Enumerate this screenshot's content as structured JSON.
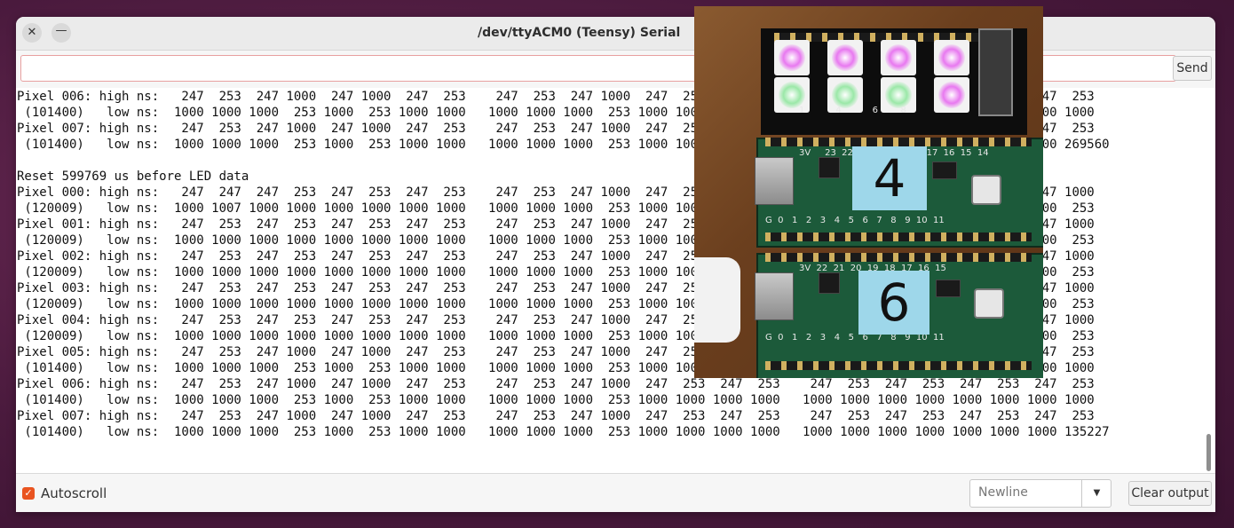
{
  "window": {
    "title": "/dev/ttyACM0 (Teensy) Serial"
  },
  "titlebar": {
    "close_icon_glyph": "✕",
    "minimize_icon_glyph": "—"
  },
  "send_bar": {
    "input_value": "",
    "send_label": "Send"
  },
  "output_lines": [
    "Pixel 006: high ns:   247  253  247 1000  247 1000  247  253    247  253  247 1000  247  253  247  253    247  253  247  253  247  253  247  253",
    " (101400)   low ns:  1000 1000 1000  253 1000  253 1000 1000   1000 1000 1000  253 1000 1000 1000 1000   1000 1000 1000 1000 1000 1000 1000 1000",
    "Pixel 007: high ns:   247  253  247 1000  247 1000  247  253    247  253  247 1000  247  253  247  253    247  253  247  253  247  253  247  253",
    " (101400)   low ns:  1000 1000 1000  253 1000  253 1000 1000   1000 1000 1000  253 1000 1000 1000 1000   1000 1000 1000 1000 1000 1000 1000 269560",
    "",
    "Reset 599769 us before LED data",
    "Pixel 000: high ns:   247  247  247  253  247  253  247  253    247  253  247 1000  247  253  247  253    247  253  247  253  247  253  247 1000",
    " (120009)   low ns:  1000 1007 1000 1000 1000 1000 1000 1000   1000 1000 1000  253 1000 1000 1000 1000   1000 1000 1000 1000 1000 1000 1000  253",
    "Pixel 001: high ns:   247  253  247  253  247  253  247  253    247  253  247 1000  247  253  247  253    247  253  247  253  247  253  247 1000",
    " (120009)   low ns:  1000 1000 1000 1000 1000 1000 1000 1000   1000 1000 1000  253 1000 1000 1000 1000   1000 1000 1000 1000 1000 1000 1000  253",
    "Pixel 002: high ns:   247  253  247  253  247  253  247  253    247  253  247 1000  247  253  247  253    247  253  247  253  247  253  247 1000",
    " (120009)   low ns:  1000 1000 1000 1000 1000 1000 1000 1000   1000 1000 1000  253 1000 1000 1000 1000   1000 1000 1000 1000 1000 1000 1000  253",
    "Pixel 003: high ns:   247  253  247  253  247  253  247  253    247  253  247 1000  247  253  247  253    247  253  247  253  247  253  247 1000",
    " (120009)   low ns:  1000 1000 1000 1000 1000 1000 1000 1000   1000 1000 1000  253 1000 1000 1000 1000   1000 1000 1000 1000 1000 1000 1000  253",
    "Pixel 004: high ns:   247  253  247  253  247  253  247  253    247  253  247 1000  247  253  247  253    247  253  247  253  247  253  247 1000",
    " (120009)   low ns:  1000 1000 1000 1000 1000 1000 1000 1000   1000 1000 1000  253 1000 1000 1000 1000   1000 1000 1000 1000 1000 1000 1000  253",
    "Pixel 005: high ns:   247  253  247 1000  247 1000  247  253    247  253  247 1000  247  253  247  253    247  253  247  253  247  253  247  253",
    " (101400)   low ns:  1000 1000 1000  253 1000  253 1000 1000   1000 1000 1000  253 1000 1000 1000 1000   1000 1000 1000 1000 1000 1000 1000 1000",
    "Pixel 006: high ns:   247  253  247 1000  247 1000  247  253    247  253  247 1000  247  253  247  253    247  253  247  253  247  253  247  253",
    " (101400)   low ns:  1000 1000 1000  253 1000  253 1000 1000   1000 1000 1000  253 1000 1000 1000 1000   1000 1000 1000 1000 1000 1000 1000 1000",
    "Pixel 007: high ns:   247  253  247 1000  247 1000  247  253    247  253  247 1000  247  253  247  253    247  253  247  253  247  253  247  253",
    " (101400)   low ns:  1000 1000 1000  253 1000  253 1000 1000   1000 1000 1000  253 1000 1000 1000 1000   1000 1000 1000 1000 1000 1000 1000 135227"
  ],
  "footer": {
    "autoscroll_label": "Autoscroll",
    "autoscroll_checked": true,
    "checkbox_glyph": "✓",
    "line_ending_value": "Newline",
    "dropdown_glyph": "▼",
    "clear_label": "Clear output"
  },
  "photo": {
    "label_top": "4",
    "label_bottom": "6",
    "silk_top": "3V     23  22  21  20  19  18  17  16  15  14",
    "silk_mid": "G  0   1   2   3   4   5   6   7   8   9  10  11",
    "silk_mid2": "3V  22  21  20  19  18  17  16  15",
    "silk_bot": "G  0   1   2   3   4   5   6   7   8   9  10  11",
    "silk_led": "1           4           6        8"
  },
  "colors": {
    "accent": "#e95420",
    "titlebar_bg": "#ebebeb",
    "desktop_bg": "#4a1a3d",
    "led_pink": "#e879f0",
    "led_green": "#9be8a8"
  }
}
